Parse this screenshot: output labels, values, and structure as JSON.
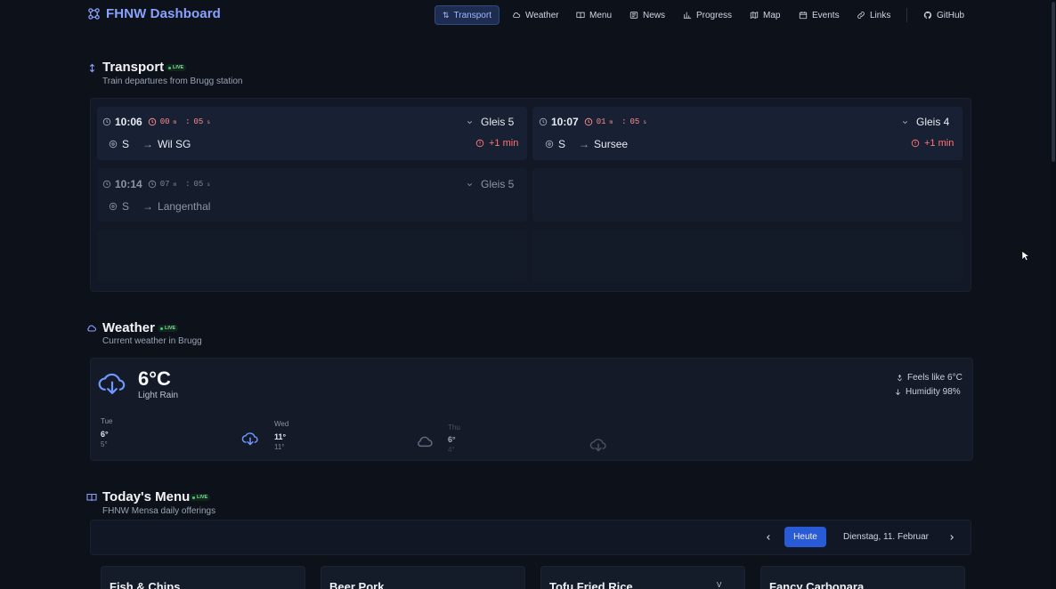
{
  "nav": {
    "brand": "FHNW Dashboard",
    "items": [
      {
        "label": "Transport",
        "icon": "train-icon",
        "active": true
      },
      {
        "label": "Weather",
        "icon": "cloud-icon"
      },
      {
        "label": "Menu",
        "icon": "book-icon"
      },
      {
        "label": "News",
        "icon": "newspaper-icon"
      },
      {
        "label": "Progress",
        "icon": "bar-chart-icon"
      },
      {
        "label": "Map",
        "icon": "map-icon"
      },
      {
        "label": "Events",
        "icon": "calendar-icon"
      },
      {
        "label": "Links",
        "icon": "link-icon"
      },
      {
        "label": "GitHub",
        "icon": "github-icon"
      }
    ]
  },
  "transport": {
    "title": "Transport",
    "live": "LIVE",
    "subtitle": "Train departures from Brugg station",
    "departures": [
      {
        "time": "10:06",
        "countdown_min": "00",
        "countdown_m_unit": "m",
        "countdown_sec": "05",
        "countdown_s_unit": "s",
        "platform": "Gleis 5",
        "line": "S",
        "arrow": "→",
        "destination": "Wil SG",
        "delay": "+1 min"
      },
      {
        "time": "10:07",
        "countdown_min": "01",
        "countdown_m_unit": "m",
        "countdown_sec": "05",
        "countdown_s_unit": "s",
        "platform": "Gleis 4",
        "line": "S",
        "arrow": "→",
        "destination": "Sursee",
        "delay": "+1 min"
      },
      {
        "time": "10:14",
        "countdown_min": "07",
        "countdown_m_unit": "m",
        "countdown_sec": "05",
        "countdown_s_unit": "s",
        "platform": "Gleis 5",
        "line": "S",
        "arrow": "→",
        "destination": "Langenthal",
        "delay": ""
      }
    ]
  },
  "weather": {
    "title": "Weather",
    "live": "LIVE",
    "subtitle": "Current weather in Brugg",
    "temperature": "6°C",
    "condition": "Light Rain",
    "feels_like": "Feels like 6°C",
    "humidity": "Humidity 98%",
    "forecast": [
      {
        "day": "Tue",
        "high": "6°",
        "low": "5°",
        "icon": "cloud-download-icon"
      },
      {
        "day": "Wed",
        "high": "11°",
        "low": "11°",
        "icon": "cloud-icon"
      },
      {
        "day": "Thu",
        "high": "6°",
        "low": "4°",
        "icon": "cloud-download-icon"
      }
    ]
  },
  "menu": {
    "title": "Today's Menu",
    "live": "LIVE",
    "subtitle": "FHNW Mensa daily offerings",
    "today_button": "Heute",
    "date": "Dienstag, 11. Februar",
    "dishes": [
      "Fish & Chips",
      "Beer Pork",
      "Tofu Fried Rice",
      "Fancy Carbonara"
    ],
    "badge": "V"
  }
}
